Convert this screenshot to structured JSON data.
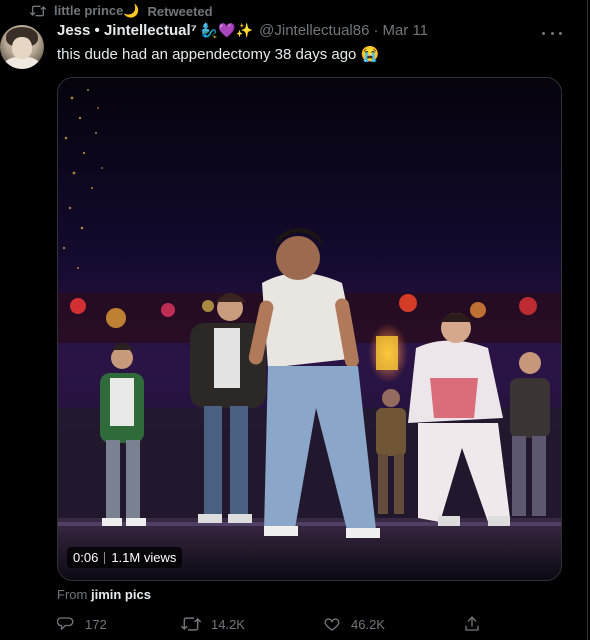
{
  "retweet": {
    "user": "little prince🌙",
    "label": "Retweeted"
  },
  "author": {
    "display_name": "Jess • Jintellectual⁷",
    "emojis": "🧞‍♂️💜✨",
    "handle": "@Jintellectual86",
    "separator": "·",
    "date": "Mar 11"
  },
  "tweet": {
    "text": "this dude had an appendectomy 38 days ago 😭"
  },
  "video": {
    "duration": "0:06",
    "views": "1.1M views"
  },
  "source": {
    "prefix": "From",
    "name": "jimin pics"
  },
  "actions": {
    "replies": "172",
    "retweets": "14.2K",
    "likes": "46.2K"
  },
  "colors": {
    "background": "#000000",
    "text_primary": "#e7e9ea",
    "text_secondary": "#71767b",
    "border": "#2f3336"
  },
  "icons": {
    "retweet_header": "retweet-icon",
    "more": "more-icon",
    "reply": "reply-icon",
    "retweet": "retweet-icon",
    "like": "heart-icon",
    "share": "share-icon"
  }
}
